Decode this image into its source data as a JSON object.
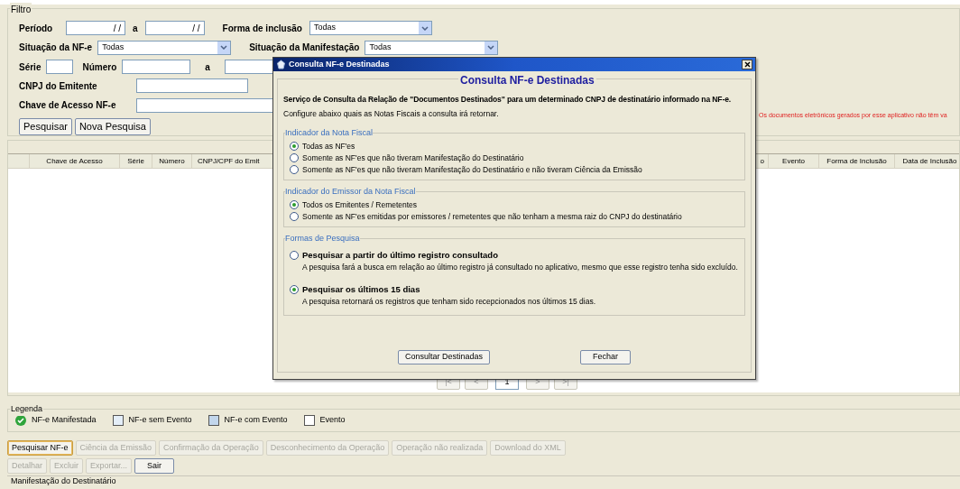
{
  "filter": {
    "legend": "Filtro",
    "periodo": {
      "label": "Período",
      "from": "/ /",
      "sep": "a",
      "to": "/ /"
    },
    "forma_inclusao": {
      "label": "Forma de inclusão",
      "value": "Todas"
    },
    "situacao_nfe": {
      "label": "Situação da NF-e",
      "value": "Todas"
    },
    "situacao_manifestacao": {
      "label": "Situação da Manifestação",
      "value": "Todas"
    },
    "serie": {
      "label": "Série"
    },
    "numero": {
      "label": "Número",
      "sep": "a"
    },
    "cnpj_emitente": {
      "label": "CNPJ do Emitente"
    },
    "chave_acesso": {
      "label": "Chave de Acesso NF-e"
    },
    "buttons": [
      "Pesquisar",
      "Nova Pesquisa"
    ]
  },
  "warning": "Os documentos eletrônicos gerados por esse aplicativo não têm va",
  "table": {
    "columns": [
      "",
      "Chave de Acesso",
      "Série",
      "Número",
      "CNPJ/CPF do Emit",
      "o",
      "Evento",
      "Forma de Inclusão",
      "Data de Inclusão"
    ]
  },
  "pager": {
    "buttons": [
      "|<",
      "<"
    ],
    "page": "1",
    "buttons_after": [
      ">",
      ">|"
    ]
  },
  "legend": {
    "title": "Legenda",
    "items": [
      {
        "kind": "check",
        "label": "NF-e Manifestada"
      },
      {
        "kind": "swatch",
        "label": "NF-e sem Evento",
        "color": "#e4eef8"
      },
      {
        "kind": "swatch",
        "label": "NF-e com Evento",
        "color": "#c2d6ec"
      },
      {
        "kind": "swatch",
        "label": "Evento",
        "color": "#ffffff"
      }
    ]
  },
  "actions": [
    {
      "label": "Pesquisar NF-e",
      "disabled": false,
      "selected": true
    },
    {
      "label": "Ciência da Emissão",
      "disabled": true,
      "selected": false
    },
    {
      "label": "Confirmação da Operação",
      "disabled": true,
      "selected": false
    },
    {
      "label": "Desconhecimento da Operação",
      "disabled": true,
      "selected": false
    },
    {
      "label": "Operação não realizada",
      "disabled": true,
      "selected": false
    },
    {
      "label": "Download do XML",
      "disabled": true,
      "selected": false
    }
  ],
  "actions2": [
    {
      "label": "Detalhar",
      "disabled": true,
      "selected": false
    },
    {
      "label": "Excluir",
      "disabled": true,
      "selected": false
    },
    {
      "label": "Exportar...",
      "disabled": true,
      "selected": false
    },
    {
      "label": "Sair",
      "disabled": false,
      "selected": false
    }
  ],
  "status_bar": "Manifestação do Destinatário",
  "dialog": {
    "title": "Consulta NF-e Destinadas",
    "heading": "Consulta NF-e Destinadas",
    "description": "Serviço de Consulta da Relação de \"Documentos Destinados\" para um determinado CNPJ de destinatário informado na NF-e.",
    "hint": "Configure abaixo quais as Notas Fiscais a consulta irá retornar.",
    "groups": [
      {
        "title": "Indicador da Nota Fiscal",
        "options": [
          {
            "label": "Todas as NF'es",
            "selected": true
          },
          {
            "label": "Somente as NF'es que não tiveram Manifestação do Destinatário",
            "selected": false
          },
          {
            "label": "Somente as NF'es que não tiveram Manifestação do Destinatário e não tiveram Ciência da Emissão",
            "selected": false
          }
        ]
      },
      {
        "title": "Indicador do Emissor da Nota Fiscal",
        "options": [
          {
            "label": "Todos os Emitentes / Remetentes",
            "selected": true
          },
          {
            "label": "Somente as NF'es emitidas por emissores / remetentes que não tenham a mesma raiz do CNPJ do destinatário",
            "selected": false
          }
        ]
      },
      {
        "title": "Formas de Pesquisa",
        "options": [
          {
            "label": "Pesquisar a partir do último registro consultado",
            "detail": "A pesquisa fará a busca em relação ao último registro já consultado no aplicativo, mesmo que esse registro tenha sido excluído.",
            "selected": false
          },
          {
            "label": "Pesquisar os últimos 15 dias",
            "detail": "A pesquisa retornará os registros que tenham sido recepcionados nos últimos 15 dias.",
            "selected": true
          }
        ]
      }
    ],
    "buttons": [
      "Consultar Destinadas",
      "Fechar"
    ]
  }
}
